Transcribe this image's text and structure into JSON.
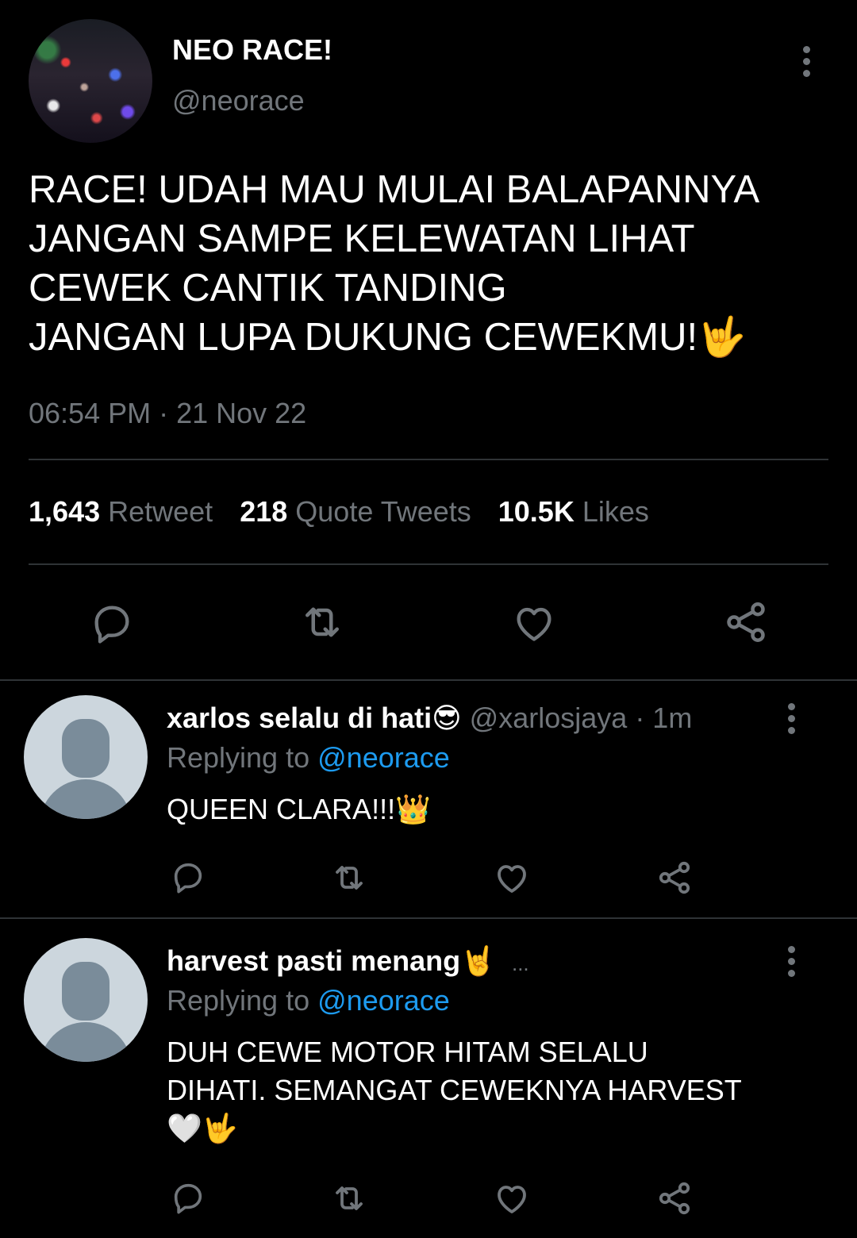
{
  "tweet": {
    "author_name": "NEO RACE!",
    "author_handle": "@neorace",
    "text_lines": [
      "RACE! UDAH MAU MULAI BALAPANNYA",
      "JANGAN SAMPE KELEWATAN LIHAT",
      "CEWEK CANTIK TANDING",
      "JANGAN LUPA DUKUNG CEWEKMU!"
    ],
    "text_emoji": "🤟",
    "timestamp": "06:54 PM · 21 Nov 22",
    "stats": {
      "retweets_count": "1,643",
      "retweets_label": "Retweet",
      "quotes_count": "218",
      "quotes_label": "Quote Tweets",
      "likes_count": "10.5K",
      "likes_label": "Likes"
    }
  },
  "replies": [
    {
      "name": "xarlos selalu di hati😎",
      "handle": "@xarlosjaya",
      "time": "· 1m",
      "replying_prefix": "Replying to",
      "replying_handle": "@neorace",
      "text": "QUEEN CLARA!!!👑"
    },
    {
      "name": "harvest pasti menang🤘",
      "ellipsis": "...",
      "replying_prefix": "Replying to",
      "replying_handle": "@neorace",
      "text_line1": "DUH CEWE MOTOR HITAM SELALU",
      "text_line2": "DIHATI. SEMANGAT CEWEKNYA HARVEST",
      "text_line3": "🤍🤟"
    }
  ],
  "colors": {
    "background": "#000000",
    "text": "#e7e9ea",
    "muted": "#71767b",
    "link": "#1d9bf0",
    "divider": "#2f3336"
  },
  "icons": {
    "reply": "comment-icon",
    "retweet": "retweet-icon",
    "like": "heart-icon",
    "share": "share-icon",
    "more": "more-vertical-icon"
  }
}
